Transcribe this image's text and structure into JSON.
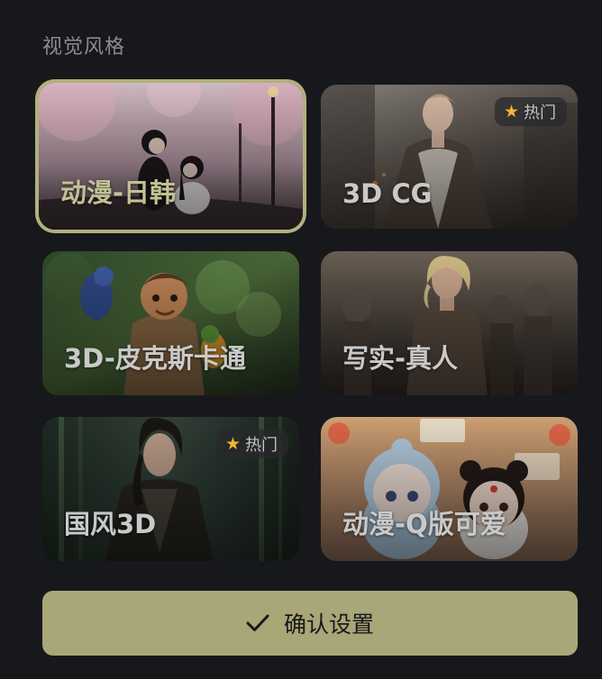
{
  "section": {
    "title": "视觉风格"
  },
  "styles": [
    {
      "label": "动漫-日韩",
      "selected": true,
      "hot": false,
      "illustration": "anime-couple-cherry-blossom"
    },
    {
      "label": "3D CG",
      "selected": false,
      "hot": true,
      "illustration": "cg-man-in-trench-coat"
    },
    {
      "label": "3D-皮克斯卡通",
      "selected": false,
      "hot": false,
      "illustration": "pixar-boy-with-parrots-jungle"
    },
    {
      "label": "写实-真人",
      "selected": false,
      "hot": false,
      "illustration": "realistic-woman-crowd"
    },
    {
      "label": "国风3D",
      "selected": false,
      "hot": true,
      "illustration": "chinese-swordsman-bamboo-forest"
    },
    {
      "label": "动漫-Q版可爱",
      "selected": false,
      "hot": false,
      "illustration": "chibi-chinese-girls-restaurant"
    }
  ],
  "badge": {
    "hot_label": "热门",
    "icon": "star-icon"
  },
  "confirm": {
    "label": "确认设置",
    "icon": "checkmark-icon"
  },
  "colors": {
    "background": "#17181c",
    "accent": "#a9a677",
    "selected_border": "#b2b07c",
    "star": "#f2b52f"
  }
}
